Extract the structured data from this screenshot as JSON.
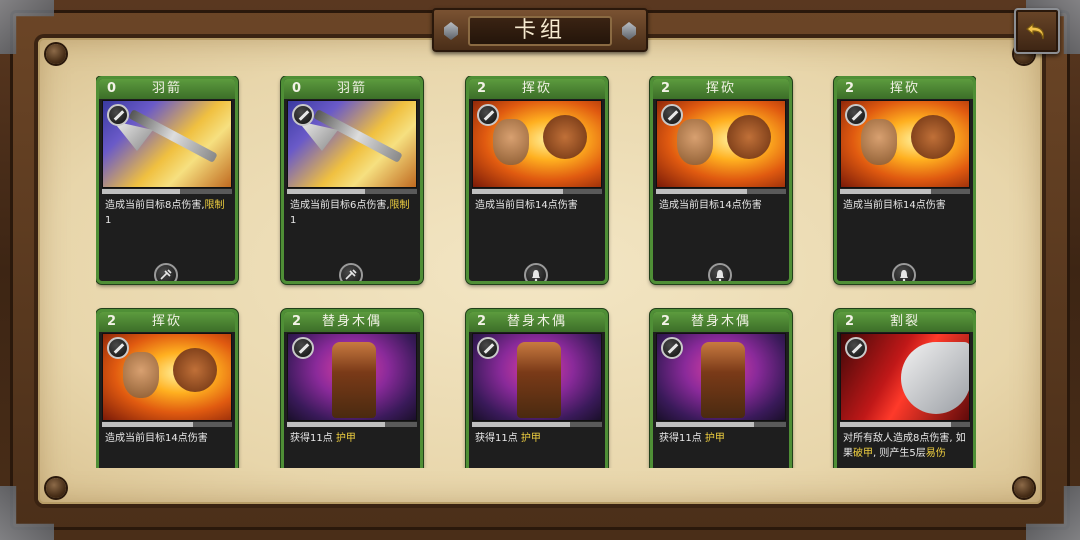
{
  "header": {
    "title": "卡组"
  },
  "cards": [
    {
      "cost": "0",
      "name": "羽箭",
      "art": "arrow",
      "desc_plain": "造成当前目标8点伤害,",
      "desc_hl": "限制",
      "desc_tail": " 1",
      "icon": "hammer-icon",
      "bar": 0.6
    },
    {
      "cost": "0",
      "name": "羽箭",
      "art": "arrow",
      "desc_plain": "造成当前目标6点伤害,",
      "desc_hl": "限制",
      "desc_tail": " 1",
      "icon": "hammer-icon",
      "bar": 0.6
    },
    {
      "cost": "2",
      "name": "挥砍",
      "art": "slash",
      "desc_plain": "造成当前目标14点伤害",
      "desc_hl": "",
      "desc_tail": "",
      "icon": "bell-icon",
      "bar": 0.7
    },
    {
      "cost": "2",
      "name": "挥砍",
      "art": "slash",
      "desc_plain": "造成当前目标14点伤害",
      "desc_hl": "",
      "desc_tail": "",
      "icon": "bell-icon",
      "bar": 0.7
    },
    {
      "cost": "2",
      "name": "挥砍",
      "art": "slash",
      "desc_plain": "造成当前目标14点伤害",
      "desc_hl": "",
      "desc_tail": "",
      "icon": "bell-icon",
      "bar": 0.7
    },
    {
      "cost": "2",
      "name": "挥砍",
      "art": "slash",
      "desc_plain": "造成当前目标14点伤害",
      "desc_hl": "",
      "desc_tail": "",
      "icon": "bell-icon",
      "bar": 0.7
    },
    {
      "cost": "2",
      "name": "替身木偶",
      "art": "puppet",
      "desc_plain": "获得11点 ",
      "desc_hl": "护甲",
      "desc_tail": "",
      "icon": "shield-icon",
      "bar": 0.75
    },
    {
      "cost": "2",
      "name": "替身木偶",
      "art": "puppet",
      "desc_plain": "获得11点 ",
      "desc_hl": "护甲",
      "desc_tail": "",
      "icon": "shield-icon",
      "bar": 0.75
    },
    {
      "cost": "2",
      "name": "替身木偶",
      "art": "puppet",
      "desc_plain": "获得11点 ",
      "desc_hl": "护甲",
      "desc_tail": "",
      "icon": "shield-icon",
      "bar": 0.75
    },
    {
      "cost": "2",
      "name": "割裂",
      "art": "split",
      "desc_plain": "对所有敌人造成8点伤害, 如果",
      "desc_hl": "破甲",
      "desc_tail": ", 则产生5层",
      "desc_hl2": "易伤",
      "icon": "bell-icon",
      "bar": 0.85
    }
  ],
  "colors": {
    "card_border": "#4f8f36",
    "highlight": "#f0d040",
    "parchment": "#e8d6ab"
  }
}
